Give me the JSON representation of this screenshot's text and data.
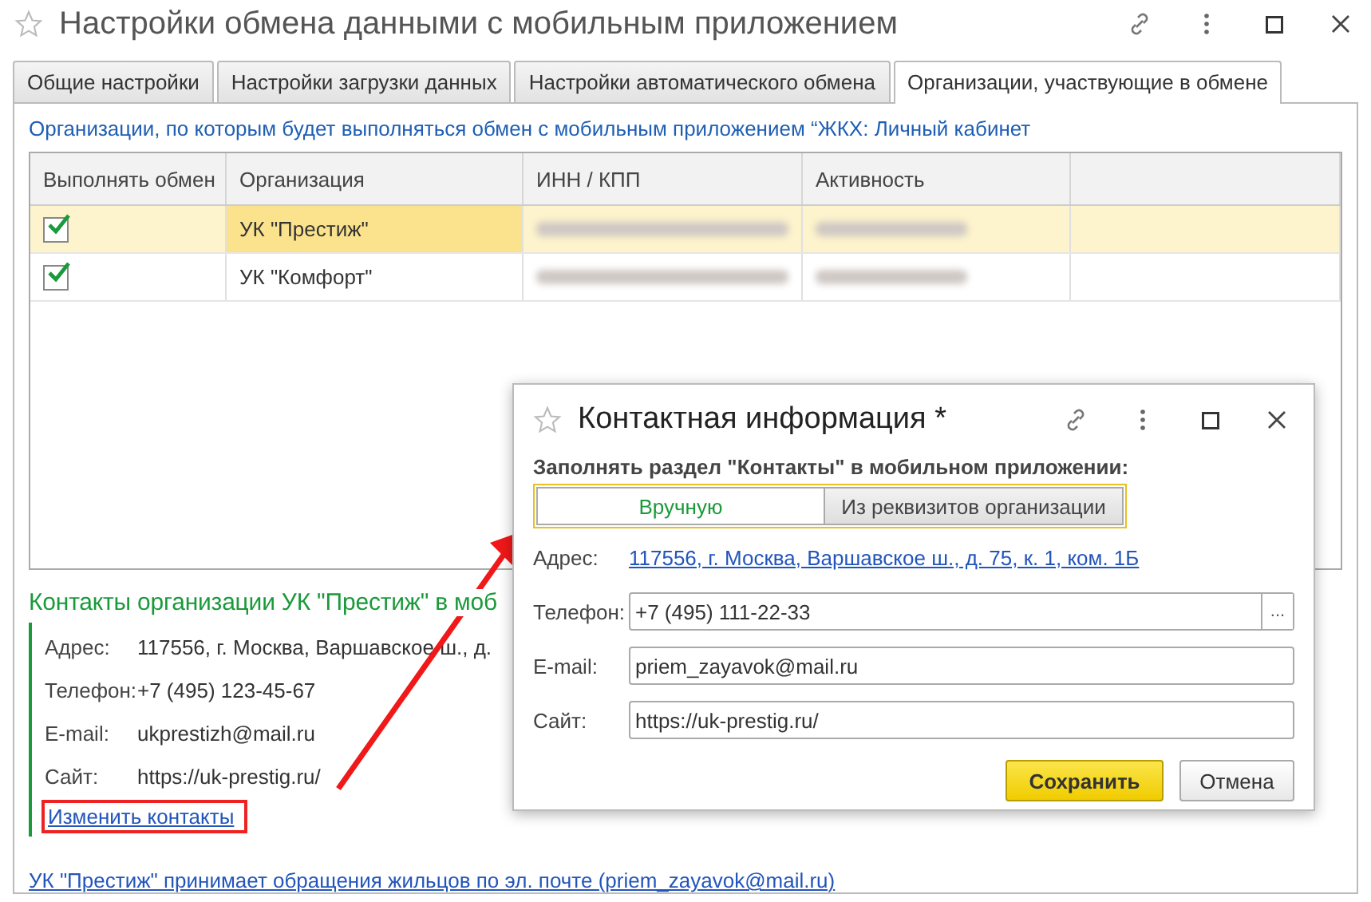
{
  "window": {
    "title": "Настройки обмена данными с мобильным приложением"
  },
  "tabs": [
    {
      "label": "Общие настройки",
      "selected": false
    },
    {
      "label": "Настройки загрузки данных",
      "selected": false
    },
    {
      "label": "Настройки автоматического обмена",
      "selected": false
    },
    {
      "label": "Организации, участвующие в обмене",
      "selected": true
    }
  ],
  "caption": "Организации, по которым будет выполняться обмен с мобильным приложением  “ЖКХ: Личный кабинет",
  "table": {
    "columns": [
      "Выполнять обмен",
      "Организация",
      "ИНН / КПП",
      "Активность"
    ],
    "rows": [
      {
        "exchange": true,
        "organization": "УК \"Престиж\"",
        "selected": true
      },
      {
        "exchange": true,
        "organization": "УК \"Комфорт\"",
        "selected": false
      }
    ]
  },
  "contacts": {
    "heading": "Контакты организации УК \"Престиж\" в моб",
    "fields": [
      {
        "label": "Адрес:",
        "value": "117556, г. Москва, Варшавское ш., д."
      },
      {
        "label": "Телефон:",
        "value": "+7 (495) 123-45-67"
      },
      {
        "label": "E-mail:",
        "value": "ukprestizh@mail.ru"
      },
      {
        "label": "Сайт:",
        "value": "https://uk-prestig.ru/"
      }
    ],
    "edit_link": "Изменить контакты"
  },
  "footer_link": "УК \"Престиж\" принимает обращения жильцов по эл. почте (priem_zayavok@mail.ru)",
  "dialog": {
    "title": "Контактная информация *",
    "mode_label": "Заполнять раздел \"Контакты\" в мобильном приложении:",
    "modes": [
      {
        "label": "Вручную",
        "selected": true
      },
      {
        "label": "Из реквизитов организации",
        "selected": false
      }
    ],
    "fields": [
      {
        "label": "Адрес:",
        "kind": "link",
        "value": "117556, г. Москва, Варшавское ш., д. 75, к. 1, ком. 1Б"
      },
      {
        "label": "Телефон:",
        "kind": "picker",
        "value": "+7 (495) 111-22-33",
        "button": "..."
      },
      {
        "label": "E-mail:",
        "kind": "input",
        "value": "priem_zayavok@mail.ru"
      },
      {
        "label": "Сайт:",
        "kind": "input",
        "value": "https://uk-prestig.ru/"
      }
    ],
    "buttons": [
      {
        "label": "Сохранить",
        "kind": "primary"
      },
      {
        "label": "Отмена",
        "kind": "default"
      }
    ]
  }
}
